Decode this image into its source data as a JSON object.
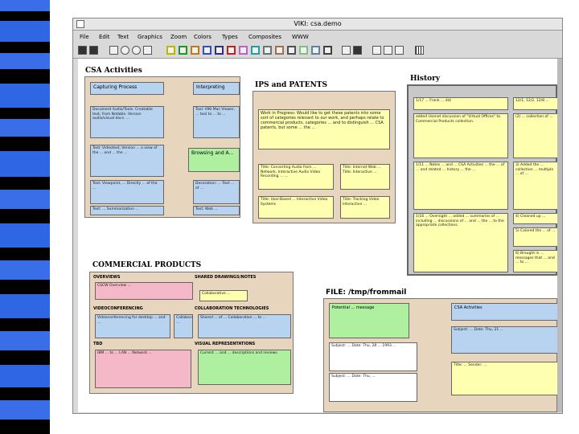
{
  "window": {
    "title": "VIKI: csa.demo",
    "menu": [
      "File",
      "Edit",
      "Text",
      "Graphics",
      "Zoom",
      "Colors",
      "Types",
      "Composites",
      "WWW"
    ]
  },
  "csa": {
    "title": "CSA Activities",
    "cards": [
      "Capturing Process",
      "Interpreting",
      "Document Audio/Tools. Creatable text, from Notable. Version audio/visual docs. ...",
      "Tool: VIKI Mac Viewer, ... tool to ... to ...",
      "Text: Videotext, Version ... a view of the ... and ... the ...",
      "Browsing and A...",
      "Text: Viewpoint, ... Directly ... of the ...",
      "Decoration: ... Text ... of ...",
      "Text: ... Summarization ...",
      "Text: Web ..."
    ]
  },
  "ips": {
    "title": "IPS and PATENTS",
    "cards": [
      "Work in Progress: Would like to get these patents into some sort of categories relevant to our work, and perhaps relate to commercial products. categories ... and to distinguish ... CSA patents, but some ... the ...",
      "Title: Converting Audio from ... Network, Interactive Audio Video Recording ... ...",
      "Title: Internet Web ... Title: Interactive ...",
      "Title: User-Based ... Interactive Video Systems",
      "Title: Tracking Video Interactive ..."
    ]
  },
  "history": {
    "title": "History",
    "cards": [
      "1/17 ... Frank ... did",
      "12/1, 12/2, 12/8 ...",
      "added Usenet discussion of \"Virtual Offices\" to Commercial Products collection.",
      "(2) ... collection of ...",
      "1/11 ... Notes ... and ... CSA Activities ... the ... of ... and related ... history ... the ...",
      "3) Added the ... collection ... multiple ... of ...",
      "1/16 ... Oversight ... added ... summaries of ... including ... discussions of ... and ... the ... to the appropriate collections.",
      "4) Cleaned up ...",
      "5) Colored the ... of ...",
      "6) Brought in ... messages that ... and ... to ..."
    ]
  },
  "commercial": {
    "title": "COMMERCIAL PRODUCTS",
    "sections": [
      "OVERVIEWS",
      "SHARED DRAWINGS/NOTES",
      "VIDEOCONFERENCING",
      "COLLABORATION TECHNOLOGIES",
      "TBD",
      "VISUAL REPRESENTATIONS"
    ],
    "cards": [
      "CSCW Overview ... ",
      "Collaborative ... ",
      "Videoconferencing for desktop ... and ... ",
      "Collaborative ... ",
      "Shared ... of ... Collaboration ... to ... ",
      "IBM ... to ... LAN ... Network ... ",
      "Current ... and ... descriptions and reviews."
    ]
  },
  "file": {
    "title": "FILE: /tmp/frommail",
    "cards": [
      "Potential ... message",
      "CSA Activities",
      "Subject: ... Date: Thu, 28 ... 1993 ...",
      "Subject: ... Date: Thu, 21 ... ",
      "Subject: ... Date: Thu, ... ",
      "Title: ... Sender: ..."
    ]
  },
  "colors": {
    "tan": "#e8d5bd",
    "yellow": "#ffffb0",
    "lightblue": "#b7d3f0",
    "green": "#aef0a0",
    "pink": "#f5b8c8",
    "gray": "#c8c8c8"
  }
}
